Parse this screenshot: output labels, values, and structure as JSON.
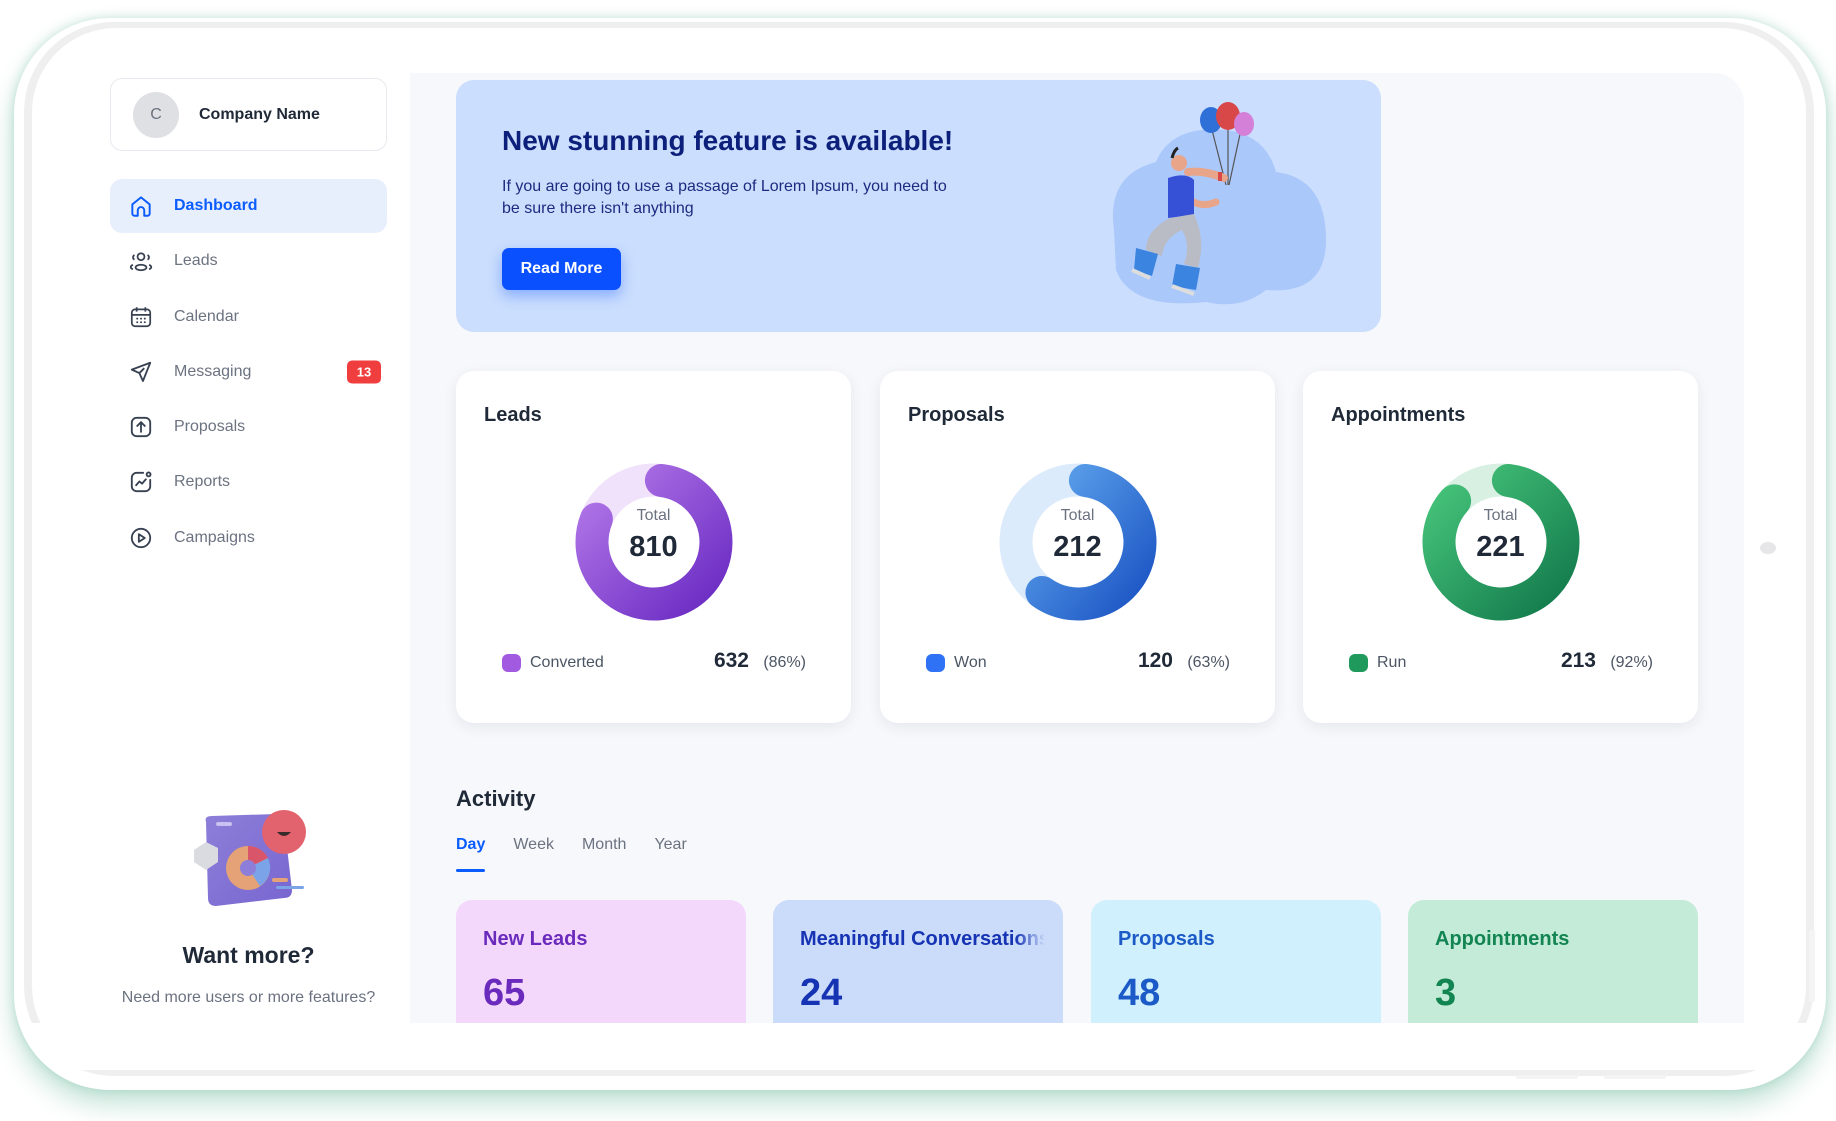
{
  "company": {
    "avatar_initial": "C",
    "name": "Company Name"
  },
  "sidebar": {
    "items": [
      {
        "label": "Dashboard",
        "icon": "home-icon",
        "active": true
      },
      {
        "label": "Leads",
        "icon": "users-icon"
      },
      {
        "label": "Calendar",
        "icon": "calendar-icon"
      },
      {
        "label": "Messaging",
        "icon": "send-icon",
        "badge": "13"
      },
      {
        "label": "Proposals",
        "icon": "upload-icon"
      },
      {
        "label": "Reports",
        "icon": "chart-icon"
      },
      {
        "label": "Campaigns",
        "icon": "play-icon"
      }
    ],
    "promo": {
      "title": "Want more?",
      "text": "Need more users or more features?"
    }
  },
  "banner": {
    "title": "New stunning feature is available!",
    "text": "If you are going to use a passage of Lorem Ipsum, you need to be sure there isn't anything",
    "button_label": "Read More"
  },
  "stats": [
    {
      "title": "Leads",
      "total_label": "Total",
      "total": "810",
      "legend_label": "Converted",
      "legend_value": "632",
      "legend_pct": "(86%)",
      "fraction": 0.86,
      "colors": {
        "start": "#b277e8",
        "end": "#6a2bc2",
        "track": "#f1e2fb",
        "dot": "#a25ae0"
      }
    },
    {
      "title": "Proposals",
      "total_label": "Total",
      "total": "212",
      "legend_label": "Won",
      "legend_value": "120",
      "legend_pct": "(63%)",
      "fraction": 0.63,
      "colors": {
        "start": "#5ea4ec",
        "end": "#1c55c4",
        "track": "#dcebfb",
        "dot": "#2f72f5"
      }
    },
    {
      "title": "Appointments",
      "total_label": "Total",
      "total": "221",
      "legend_label": "Run",
      "legend_value": "213",
      "legend_pct": "(92%)",
      "fraction": 0.92,
      "colors": {
        "start": "#46c47a",
        "end": "#137a4c",
        "track": "#d7f0e2",
        "dot": "#1f9a5c"
      }
    }
  ],
  "activity": {
    "title": "Activity",
    "tabs": [
      {
        "label": "Day",
        "active": true
      },
      {
        "label": "Week"
      },
      {
        "label": "Month"
      },
      {
        "label": "Year"
      }
    ],
    "cards": [
      {
        "label": "New Leads",
        "value": "65",
        "bg": "#f4d8fc",
        "fg": "#6a2bbd"
      },
      {
        "label": "Meaningful Conversations",
        "value": "24",
        "bg": "#cbdcfb",
        "fg": "#1633b3"
      },
      {
        "label": "Proposals",
        "value": "48",
        "bg": "#d0f0fd",
        "fg": "#1c5ac7"
      },
      {
        "label": "Appointments",
        "value": "3",
        "bg": "#c3ebd7",
        "fg": "#138552"
      }
    ]
  }
}
